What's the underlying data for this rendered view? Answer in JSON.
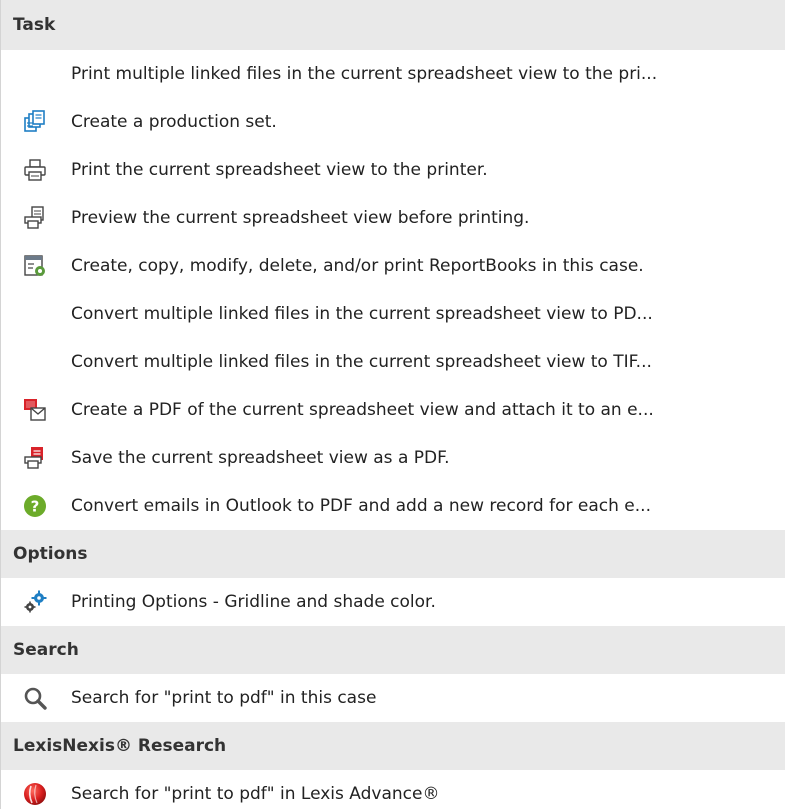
{
  "sections": {
    "task": {
      "title": "Task",
      "items": [
        {
          "label": "Print multiple linked files in the current spreadsheet view to the pri...",
          "icon": "none"
        },
        {
          "label": "Create a production set.",
          "icon": "production-set-icon"
        },
        {
          "label": "Print the current spreadsheet view to the printer.",
          "icon": "printer-icon"
        },
        {
          "label": "Preview the current spreadsheet view before printing.",
          "icon": "print-preview-icon"
        },
        {
          "label": "Create, copy, modify, delete, and/or print ReportBooks in this case.",
          "icon": "reportbook-icon"
        },
        {
          "label": "Convert multiple linked files in the current spreadsheet view to PD...",
          "icon": "none"
        },
        {
          "label": "Convert multiple linked files in the current spreadsheet view to TIF...",
          "icon": "none"
        },
        {
          "label": "Create a PDF of the current spreadsheet view and attach it to an e...",
          "icon": "pdf-email-icon"
        },
        {
          "label": "Save the current spreadsheet view as a PDF.",
          "icon": "save-pdf-icon"
        },
        {
          "label": "Convert emails in Outlook to PDF and add a new record for each e...",
          "icon": "help-question-icon"
        }
      ]
    },
    "options": {
      "title": "Options",
      "items": [
        {
          "label": "Printing Options - Gridline and shade color.",
          "icon": "gears-icon"
        }
      ]
    },
    "search": {
      "title": "Search",
      "items": [
        {
          "label": "Search for \"print to pdf\" in this case",
          "icon": "search-icon"
        }
      ]
    },
    "lexis": {
      "title": "LexisNexis® Research",
      "items": [
        {
          "label": "Search for \"print to pdf\" in Lexis Advance®",
          "icon": "lexis-advance-icon"
        }
      ]
    }
  },
  "colors": {
    "header_bg": "#e9e9e9",
    "accent_blue": "#1f7fc4",
    "pdf_red": "#d9232a",
    "help_green": "#6cab2a"
  }
}
